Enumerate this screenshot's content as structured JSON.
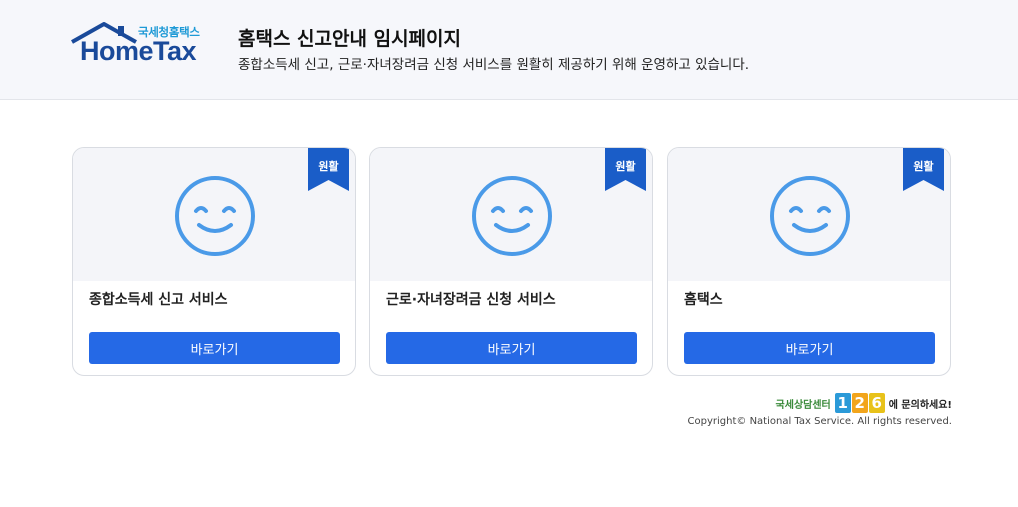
{
  "header": {
    "logo_small": "국세청홈택스",
    "logo_main": "HomeTax",
    "title": "홈택스 신고안내 임시페이지",
    "subtitle": "종합소득세 신고, 근로·자녀장려금 신청 서비스를 원활히 제공하기 위해 운영하고 있습니다."
  },
  "cards": [
    {
      "status": "원활",
      "title": "종합소득세 신고 서비스",
      "button": "바로가기"
    },
    {
      "status": "원활",
      "title": "근로·자녀장려금 신청 서비스",
      "button": "바로가기"
    },
    {
      "status": "원활",
      "title": "홈택스",
      "button": "바로가기"
    }
  ],
  "footer": {
    "center_prefix": "국세상담센터",
    "center_number": [
      "1",
      "2",
      "6"
    ],
    "center_suffix": "에 문의하세요!",
    "copyright": "Copyright© National Tax Service. All rights reserved."
  },
  "colors": {
    "accent": "#2569e6",
    "ribbon": "#1a5dc8",
    "smile": "#4a9ae8",
    "digit_1": "#2b9ad8",
    "digit_2": "#f2a51c",
    "digit_3": "#e8c21a"
  },
  "icons": {
    "status_icon": "smile-face-icon",
    "logo_icon": "house-roof-icon"
  }
}
